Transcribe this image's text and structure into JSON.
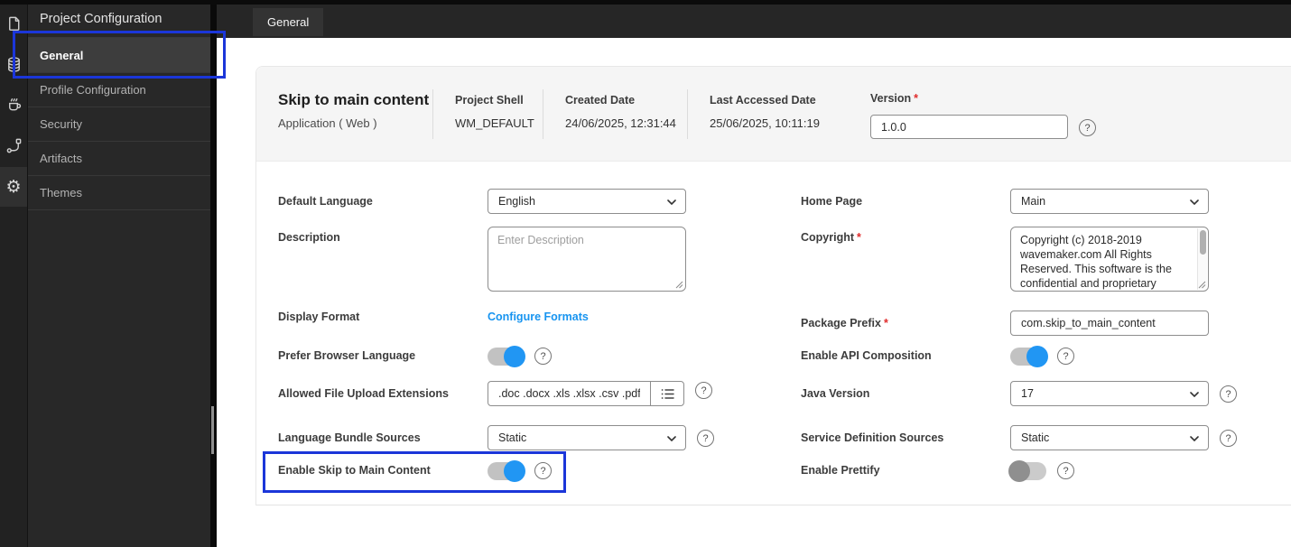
{
  "ui": {
    "required_marker": "*",
    "help_glyph": "?"
  },
  "colors": {
    "accent_blue": "#2196f3",
    "link_blue": "#1794f0",
    "annotation_blue": "#1b36d9",
    "required_red": "#e02b2b",
    "sidebar_bg": "#282828",
    "topbar_bg": "#262626",
    "card_header_bg": "#f5f5f5"
  },
  "sidebar": {
    "title": "Project Configuration",
    "rail_icons": [
      "pages-icon",
      "database-icon",
      "java-services-icon",
      "apis-icon",
      "settings-gear-icon"
    ],
    "items": [
      {
        "label": "General",
        "active": true
      },
      {
        "label": "Profile Configuration",
        "active": false
      },
      {
        "label": "Security",
        "active": false
      },
      {
        "label": "Artifacts",
        "active": false
      },
      {
        "label": "Themes",
        "active": false
      }
    ]
  },
  "topbar": {
    "tab": "General"
  },
  "project_header": {
    "title": "Skip to main content",
    "subtitle": "Application ( Web )",
    "meta": [
      {
        "label": "Project Shell",
        "value": "WM_DEFAULT"
      },
      {
        "label": "Created Date",
        "value": "24/06/2025, 12:31:44"
      },
      {
        "label": "Last Accessed Date",
        "value": "25/06/2025, 10:11:19"
      }
    ],
    "version": {
      "label": "Version",
      "required": true,
      "value": "1.0.0"
    }
  },
  "form": {
    "left": {
      "default_language": {
        "label": "Default Language",
        "value": "English"
      },
      "description": {
        "label": "Description",
        "placeholder": "Enter Description"
      },
      "display_format": {
        "label": "Display Format",
        "link_label": "Configure Formats"
      },
      "prefer_browser_language": {
        "label": "Prefer Browser Language",
        "state": "on"
      },
      "allowed_file_upload_extensions": {
        "label": "Allowed File Upload Extensions",
        "value": ".doc .docx .xls .xlsx .csv .pdf .txt"
      },
      "language_bundle_sources": {
        "label": "Language Bundle Sources",
        "value": "Static"
      },
      "enable_skip_to_main_content": {
        "label": "Enable Skip to Main Content",
        "state": "on"
      }
    },
    "right": {
      "home_page": {
        "label": "Home Page",
        "value": "Main"
      },
      "copyright": {
        "label": "Copyright",
        "required": true,
        "value": "Copyright (c) 2018-2019 wavemaker.com All Rights Reserved.  This software is the confidential and proprietary information of"
      },
      "package_prefix": {
        "label": "Package Prefix",
        "required": true,
        "value": "com.skip_to_main_content"
      },
      "enable_api_composition": {
        "label": "Enable API Composition",
        "state": "on"
      },
      "java_version": {
        "label": "Java Version",
        "value": "17"
      },
      "service_definition_sources": {
        "label": "Service Definition Sources",
        "value": "Static"
      },
      "enable_prettify": {
        "label": "Enable Prettify",
        "state": "off"
      }
    }
  }
}
